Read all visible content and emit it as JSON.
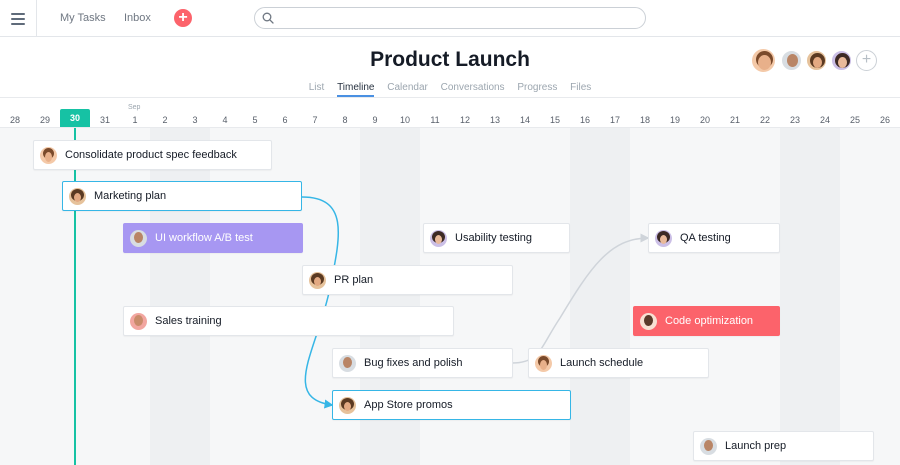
{
  "nav": {
    "my_tasks": "My Tasks",
    "inbox": "Inbox",
    "add_symbol": "+",
    "search_placeholder": ""
  },
  "project": {
    "title": "Product Launch",
    "add_member_symbol": "+"
  },
  "tabs": [
    {
      "label": "List",
      "active": false
    },
    {
      "label": "Timeline",
      "active": true
    },
    {
      "label": "Calendar",
      "active": false
    },
    {
      "label": "Conversations",
      "active": false
    },
    {
      "label": "Progress",
      "active": false
    },
    {
      "label": "Files",
      "active": false
    }
  ],
  "timeline": {
    "month_label": "Sep",
    "dates": [
      "28",
      "29",
      "30",
      "31",
      "1",
      "2",
      "3",
      "4",
      "5",
      "6",
      "7",
      "8",
      "9",
      "10",
      "11",
      "12",
      "13",
      "14",
      "15",
      "16",
      "17",
      "18",
      "19",
      "20",
      "21",
      "22",
      "23",
      "24",
      "25",
      "26"
    ],
    "today": "30"
  },
  "tasks": [
    {
      "name": "Consolidate product spec feedback"
    },
    {
      "name": "Marketing plan"
    },
    {
      "name": "UI workflow A/B test"
    },
    {
      "name": "Usability testing"
    },
    {
      "name": "QA testing"
    },
    {
      "name": "PR plan"
    },
    {
      "name": "Sales training"
    },
    {
      "name": "Code optimization"
    },
    {
      "name": "Bug fixes and polish"
    },
    {
      "name": "Launch schedule"
    },
    {
      "name": "App Store promos"
    },
    {
      "name": "Launch prep"
    }
  ],
  "colors": {
    "accent_teal": "#16c2a4",
    "selected_border": "#36b6e6",
    "purple_task": "#a797f2",
    "red_task": "#fc636b",
    "active_tab_underline": "#4a90e2"
  },
  "icons": {
    "menu": "hamburger-icon",
    "add": "plus-icon",
    "search": "search-icon",
    "add_member": "plus-circle-icon"
  }
}
